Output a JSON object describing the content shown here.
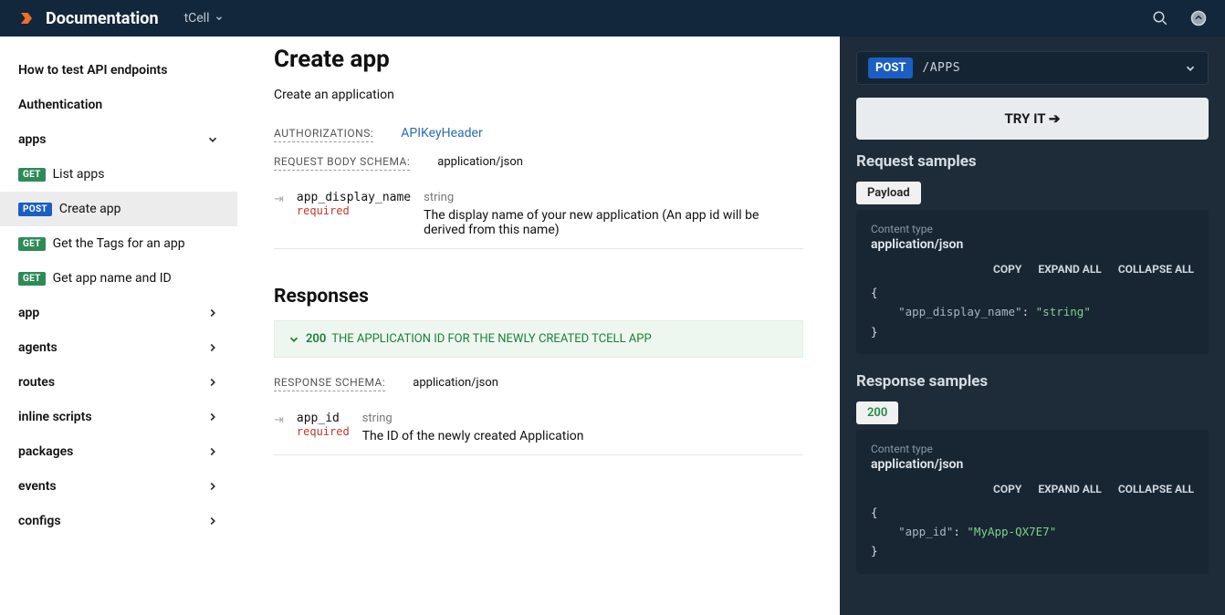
{
  "header": {
    "brand": "Documentation",
    "product": "tCell"
  },
  "sidebar": {
    "link_test": "How to test API endpoints",
    "link_auth": "Authentication",
    "apps": {
      "label": "apps",
      "items": [
        {
          "badge": "GET",
          "label": "List apps"
        },
        {
          "badge": "POST",
          "label": "Create app",
          "active": true
        },
        {
          "badge": "GET",
          "label": "Get the Tags for an app"
        },
        {
          "badge": "GET",
          "label": "Get app name and ID"
        }
      ]
    },
    "sections": [
      "app",
      "agents",
      "routes",
      "inline scripts",
      "packages",
      "events",
      "configs"
    ]
  },
  "page": {
    "title": "Create app",
    "description": "Create an application",
    "auth_label": "AUTHORIZATIONS:",
    "auth_value": "APIKeyHeader",
    "body_label": "REQUEST BODY SCHEMA:",
    "body_value": "application/json",
    "param1": {
      "name": "app_display_name",
      "required": "required",
      "type": "string",
      "desc": "The display name of your new application (An app id will be derived from this name)"
    },
    "responses_title": "Responses",
    "resp200_code": "200",
    "resp200_text": "THE APPLICATION ID FOR THE NEWLY CREATED TCELL APP",
    "resp_schema_label": "RESPONSE SCHEMA:",
    "resp_schema_value": "application/json",
    "param2": {
      "name": "app_id",
      "required": "required",
      "type": "string",
      "desc": "The ID of the newly created Application"
    }
  },
  "right": {
    "method": "POST",
    "path": "/APPS",
    "tryit": "TRY IT ➔",
    "req_title": "Request samples",
    "req_tab": "Payload",
    "ct_label": "Content type",
    "ct_value": "application/json",
    "actions": {
      "copy": "COPY",
      "expand": "EXPAND ALL",
      "collapse": "COLLAPSE ALL"
    },
    "req_code": {
      "key": "\"app_display_name\"",
      "val": "\"string\""
    },
    "resp_title": "Response samples",
    "resp_tab": "200",
    "resp_code": {
      "key": "\"app_id\"",
      "val": "\"MyApp-QX7E7\""
    }
  }
}
